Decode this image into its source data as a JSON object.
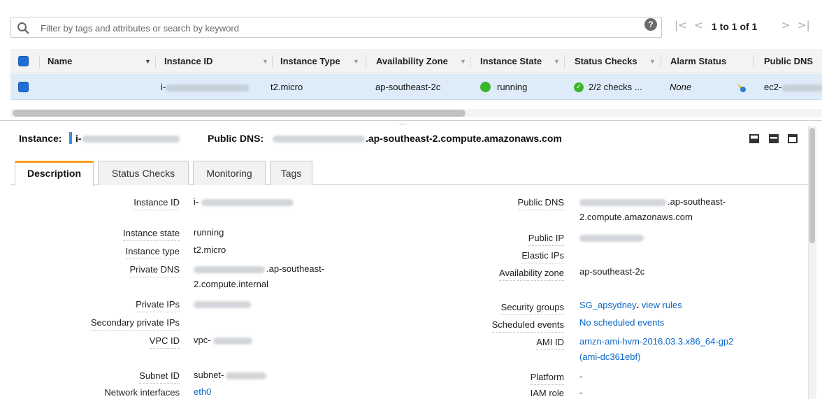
{
  "filter": {
    "placeholder": "Filter by tags and attributes or search by keyword",
    "help_glyph": "?",
    "pager": {
      "first": "|<",
      "prev": "<",
      "text": "1 to 1 of 1",
      "next": ">",
      "last": ">|"
    }
  },
  "grid": {
    "columns": [
      "Name",
      "Instance ID",
      "Instance Type",
      "Availability Zone",
      "Instance State",
      "Status Checks",
      "Alarm Status",
      "Public DNS"
    ],
    "row": {
      "name": "",
      "instance_id_prefix": "i-",
      "instance_type": "t2.micro",
      "availability_zone": "ap-southeast-2c",
      "instance_state": "running",
      "status_checks": "2/2 checks ...",
      "alarm_status": "None",
      "public_dns_prefix": "ec2-"
    }
  },
  "details": {
    "instance_label": "Instance:",
    "instance_prefix": "i-",
    "public_dns_label": "Public DNS:",
    "public_dns_suffix": ".ap-southeast-2.compute.amazonaws.com",
    "tabs": [
      "Description",
      "Status Checks",
      "Monitoring",
      "Tags"
    ],
    "left_fields": {
      "instance_id": {
        "label": "Instance ID",
        "value": "i-"
      },
      "instance_state": {
        "label": "Instance state",
        "value": "running"
      },
      "instance_type": {
        "label": "Instance type",
        "value": "t2.micro"
      },
      "private_dns": {
        "label": "Private DNS",
        "value_line1": ".ap-southeast-",
        "value_line2": "2.compute.internal"
      },
      "private_ips": {
        "label": "Private IPs",
        "value": ""
      },
      "secondary_private_ips": {
        "label": "Secondary private IPs",
        "value": ""
      },
      "vpc_id": {
        "label": "VPC ID",
        "value": "vpc-"
      },
      "subnet_id": {
        "label": "Subnet ID",
        "value": "subnet-"
      },
      "network_interfaces": {
        "label": "Network interfaces",
        "value": "eth0"
      }
    },
    "right_fields": {
      "public_dns": {
        "label": "Public DNS",
        "value_line1": ".ap-southeast-",
        "value_line2": "2.compute.amazonaws.com"
      },
      "public_ip": {
        "label": "Public IP",
        "value": ""
      },
      "elastic_ips": {
        "label": "Elastic IPs",
        "value": ""
      },
      "availability_zone": {
        "label": "Availability zone",
        "value": "ap-southeast-2c"
      },
      "security_groups": {
        "label": "Security groups",
        "value": "SG_apsydney",
        "sep": ".",
        "link": "view rules"
      },
      "scheduled_events": {
        "label": "Scheduled events",
        "value": "No scheduled events"
      },
      "ami_id": {
        "label": "AMI ID",
        "value_line1": "amzn-ami-hvm-2016.03.3.x86_64-gp2",
        "value_line2": "(ami-dc361ebf)"
      },
      "platform": {
        "label": "Platform",
        "value": "-"
      },
      "iam_role": {
        "label": "IAM role",
        "value": "-"
      }
    }
  },
  "colors": {
    "accent_tab": "#f59d1b",
    "selection": "#ddecf8",
    "running": "#3cb52a",
    "link": "#0a67c9",
    "checkbox": "#1f6ed6"
  }
}
